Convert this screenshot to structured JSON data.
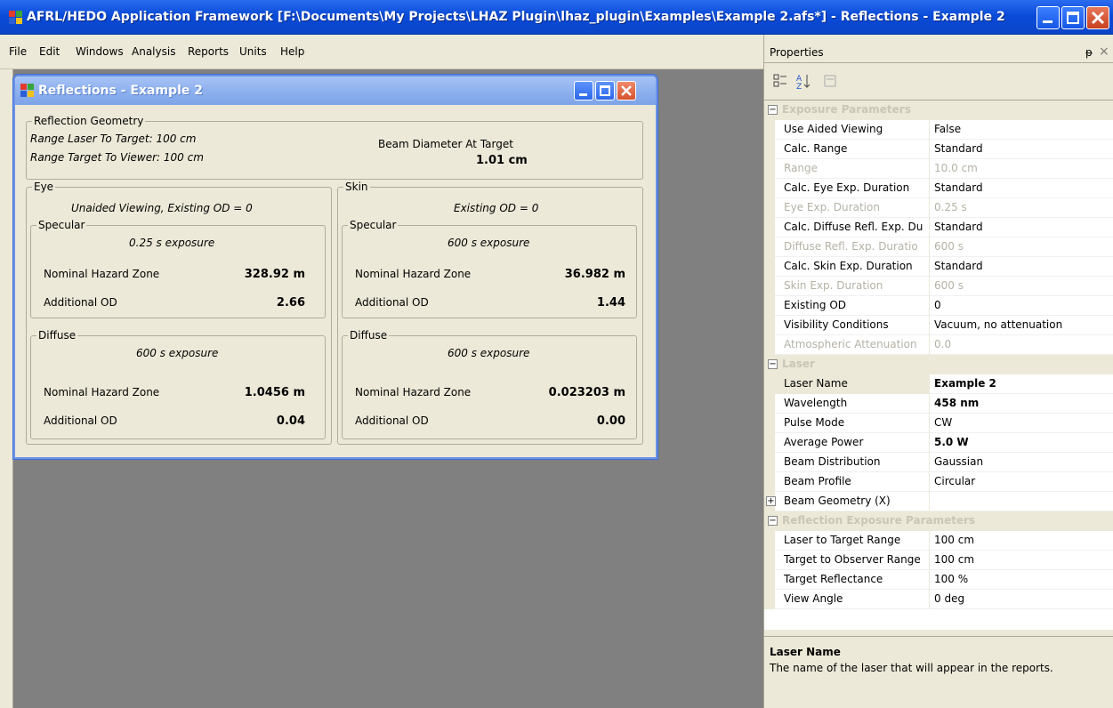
{
  "app": {
    "title": "AFRL/HEDO Application Framework [F:\\Documents\\My Projects\\LHAZ Plugin\\lhaz_plugin\\Examples\\Example 2.afs*] - Reflections - Example 2"
  },
  "menu": [
    "File",
    "Edit",
    "Windows",
    "Analysis",
    "Reports",
    "Units",
    "Help"
  ],
  "child_window": {
    "title": "Reflections - Example 2",
    "geometry": {
      "label": "Reflection Geometry",
      "range_laser_target": "Range Laser To Target: 100 cm",
      "range_target_viewer": "Range Target To Viewer: 100 cm",
      "beam_diam_label": "Beam Diameter At Target",
      "beam_diam_value": "1.01 cm"
    },
    "eye": {
      "label": "Eye",
      "subtitle": "Unaided Viewing, Existing OD = 0",
      "specular": {
        "label": "Specular",
        "exposure": "0.25 s exposure",
        "nhz_label": "Nominal Hazard Zone",
        "nhz": "328.92 m",
        "od_label": "Additional OD",
        "od": "2.66"
      },
      "diffuse": {
        "label": "Diffuse",
        "exposure": "600 s exposure",
        "nhz_label": "Nominal Hazard Zone",
        "nhz": "1.0456 m",
        "od_label": "Additional OD",
        "od": "0.04"
      }
    },
    "skin": {
      "label": "Skin",
      "subtitle": "Existing OD = 0",
      "specular": {
        "label": "Specular",
        "exposure": "600 s exposure",
        "nhz_label": "Nominal Hazard Zone",
        "nhz": "36.982 m",
        "od_label": "Additional OD",
        "od": "1.44"
      },
      "diffuse": {
        "label": "Diffuse",
        "exposure": "600 s exposure",
        "nhz_label": "Nominal Hazard Zone",
        "nhz": "0.023203 m",
        "od_label": "Additional OD",
        "od": "0.00"
      }
    }
  },
  "properties": {
    "title": "Properties",
    "pin": "ᵽ",
    "close": "×",
    "categories": [
      {
        "name": "Exposure Parameters",
        "expanded": true,
        "rows": [
          {
            "k": "Use Aided Viewing",
            "v": "False"
          },
          {
            "k": "Calc. Range",
            "v": "Standard"
          },
          {
            "k": "Range",
            "v": "10.0 cm",
            "disabled": true
          },
          {
            "k": "Calc. Eye Exp. Duration",
            "v": "Standard"
          },
          {
            "k": "Eye Exp. Duration",
            "v": "0.25 s",
            "disabled": true
          },
          {
            "k": "Calc. Diffuse Refl. Exp. Du",
            "v": "Standard"
          },
          {
            "k": "Diffuse Refl. Exp. Duratio",
            "v": "600 s",
            "disabled": true
          },
          {
            "k": "Calc. Skin Exp. Duration",
            "v": "Standard"
          },
          {
            "k": "Skin Exp. Duration",
            "v": "600 s",
            "disabled": true
          },
          {
            "k": "Existing OD",
            "v": "0"
          },
          {
            "k": "Visibility Conditions",
            "v": "Vacuum, no attenuation"
          },
          {
            "k": "Atmospheric Attenuation",
            "v": "0.0",
            "disabled": true
          }
        ]
      },
      {
        "name": "Laser",
        "expanded": true,
        "rows": [
          {
            "k": "Laser Name",
            "v": "Example 2",
            "bold": true,
            "selected": true
          },
          {
            "k": "Wavelength",
            "v": "458 nm",
            "bold": true
          },
          {
            "k": "Pulse Mode",
            "v": "CW"
          },
          {
            "k": "Average Power",
            "v": "5.0 W",
            "bold": true
          },
          {
            "k": "Beam Distribution",
            "v": "Gaussian"
          },
          {
            "k": "Beam Profile",
            "v": "Circular"
          },
          {
            "k": "Beam Geometry (X)",
            "v": "",
            "expandable": true
          }
        ]
      },
      {
        "name": "Reflection Exposure Parameters",
        "expanded": true,
        "rows": [
          {
            "k": "Laser to Target Range",
            "v": "100 cm"
          },
          {
            "k": "Target to Observer Range",
            "v": "100 cm"
          },
          {
            "k": "Target Reflectance",
            "v": "100 %"
          },
          {
            "k": "View Angle",
            "v": "0 deg"
          }
        ]
      }
    ],
    "help_title": "Laser Name",
    "help_text": "The name of the laser that will appear in the reports."
  }
}
